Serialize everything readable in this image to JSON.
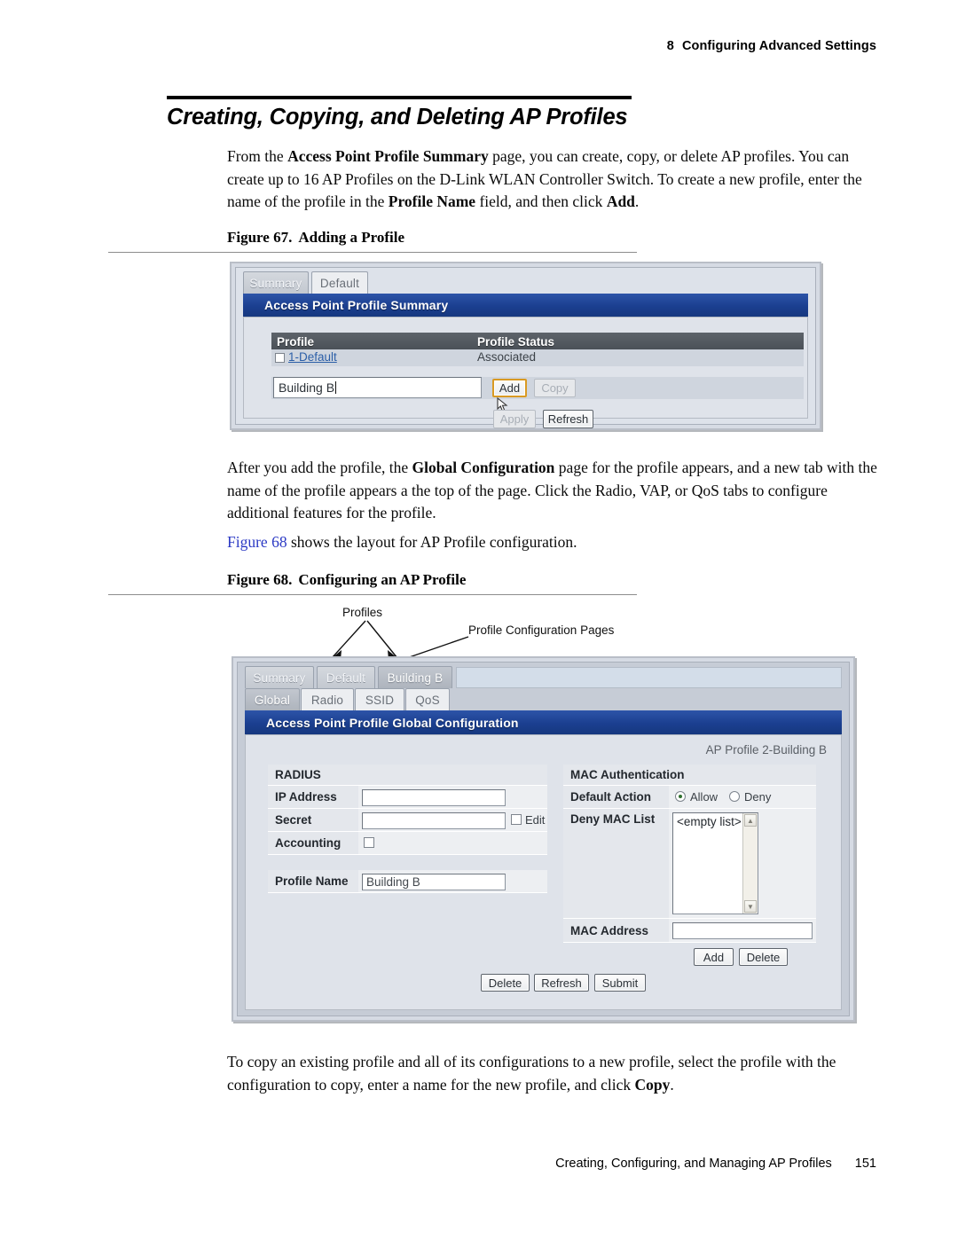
{
  "page": {
    "chapter_number": "8",
    "chapter_title": "Configuring Advanced Settings",
    "footer_text": "Creating, Configuring, and Managing AP Profiles",
    "page_number": "151"
  },
  "section": {
    "title": "Creating, Copying, and Deleting AP Profiles"
  },
  "paragraphs": {
    "p1_a": "From the ",
    "p1_b": "Access Point Profile Summary",
    "p1_c": " page, you can create, copy, or delete AP profiles. You can create up to 16 AP Profiles on the D-Link WLAN Controller Switch. To create a new profile, enter the name of the profile in the ",
    "p1_d": "Profile Name",
    "p1_e": " field, and then click ",
    "p1_f": "Add",
    "p1_g": ".",
    "p2_a": "After you add the profile, the ",
    "p2_b": "Global Configuration",
    "p2_c": " page for the profile appears, and a new tab with the name of the profile appears a the top of the page. Click the Radio, VAP, or QoS tabs to configure additional features for the profile.",
    "p3_link": "Figure 68",
    "p3_rest": " shows the layout for AP Profile configuration.",
    "p4_a": "To copy an existing profile and all of its configurations to a new profile, select the profile with the configuration to copy, enter a name for the new profile, and click ",
    "p4_b": "Copy",
    "p4_c": "."
  },
  "figure67": {
    "caption_label": "Figure 67.",
    "caption_text": "Adding a Profile",
    "tabs": [
      {
        "label": "Summary",
        "state": "inactive"
      },
      {
        "label": "Default",
        "state": "light"
      }
    ],
    "panel_title": "Access Point Profile Summary",
    "table": {
      "headers": [
        "Profile",
        "Profile Status"
      ],
      "rows": [
        {
          "profile": "1-Default",
          "status": "Associated"
        }
      ]
    },
    "new_profile_input_value": "Building B",
    "buttons": {
      "add": "Add",
      "copy": "Copy",
      "apply": "Apply",
      "refresh": "Refresh"
    }
  },
  "figure68": {
    "caption_label": "Figure 68.",
    "caption_text": "Configuring an AP Profile",
    "annotations": {
      "profiles": "Profiles",
      "config_pages": "Profile Configuration Pages"
    },
    "profile_tabs": [
      {
        "label": "Summary",
        "state": "inactive"
      },
      {
        "label": "Default",
        "state": "inactive"
      },
      {
        "label": "Building B",
        "state": "sel"
      }
    ],
    "config_tabs": [
      {
        "label": "Global",
        "state": "sel"
      },
      {
        "label": "Radio",
        "state": "light"
      },
      {
        "label": "SSID",
        "state": "light"
      },
      {
        "label": "QoS",
        "state": "light"
      }
    ],
    "panel_title": "Access Point Profile Global Configuration",
    "profile_badge": "AP Profile 2-Building B",
    "radius": {
      "section_title": "RADIUS",
      "ip_address_label": "IP Address",
      "ip_address_value": "",
      "secret_label": "Secret",
      "secret_value": "",
      "secret_edit_label": "Edit",
      "accounting_label": "Accounting",
      "profile_name_label": "Profile Name",
      "profile_name_value": "Building B"
    },
    "mac_auth": {
      "section_title": "MAC Authentication",
      "default_action_label": "Default Action",
      "option_allow": "Allow",
      "option_deny": "Deny",
      "selected_action": "Allow",
      "deny_list_label": "Deny MAC List",
      "deny_list_value": "<empty list>",
      "mac_address_label": "MAC Address",
      "mac_address_value": "",
      "add_button": "Add",
      "delete_button": "Delete"
    },
    "footer_buttons": {
      "delete": "Delete",
      "refresh": "Refresh",
      "submit": "Submit"
    }
  }
}
